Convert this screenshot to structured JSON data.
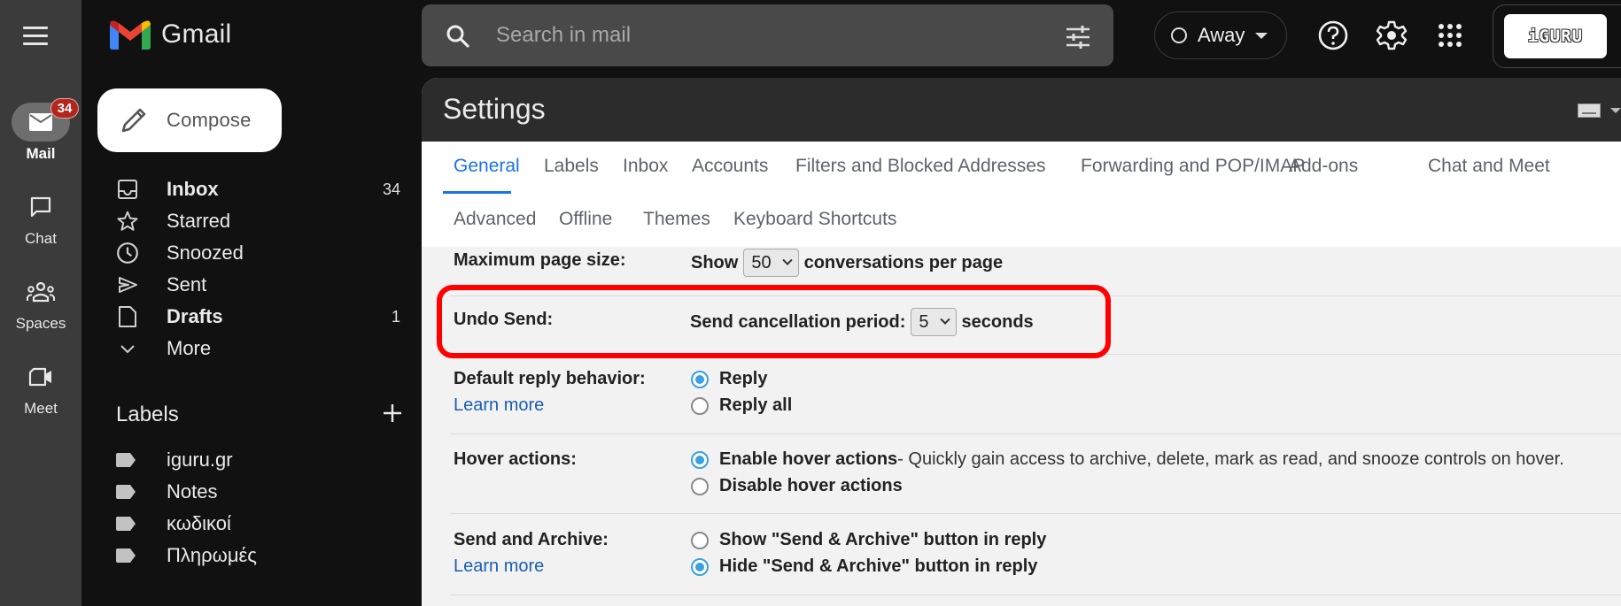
{
  "app": {
    "name": "Gmail"
  },
  "rail": {
    "items": [
      {
        "label": "Mail",
        "icon": "mail-icon",
        "badge": "34",
        "active": true
      },
      {
        "label": "Chat",
        "icon": "chat-icon"
      },
      {
        "label": "Spaces",
        "icon": "spaces-icon"
      },
      {
        "label": "Meet",
        "icon": "video-icon"
      }
    ]
  },
  "compose": {
    "label": "Compose"
  },
  "nav": {
    "items": [
      {
        "label": "Inbox",
        "icon": "inbox-icon",
        "count": "34",
        "bold": true
      },
      {
        "label": "Starred",
        "icon": "star-icon"
      },
      {
        "label": "Snoozed",
        "icon": "clock-icon"
      },
      {
        "label": "Sent",
        "icon": "send-icon"
      },
      {
        "label": "Drafts",
        "icon": "draft-icon",
        "count": "1",
        "bold": true
      },
      {
        "label": "More",
        "icon": "chevron-down-icon"
      }
    ]
  },
  "labels": {
    "title": "Labels",
    "items": [
      {
        "label": "iguru.gr"
      },
      {
        "label": "Notes"
      },
      {
        "label": "κωδικοί"
      },
      {
        "label": "Πληρωμές"
      }
    ]
  },
  "search": {
    "placeholder": "Search in mail",
    "value": ""
  },
  "status": {
    "label": "Away"
  },
  "account": {
    "logo_text": "iGURU"
  },
  "settings": {
    "title": "Settings",
    "tabs_row1": [
      "General",
      "Labels",
      "Inbox",
      "Accounts",
      "Filters and Blocked Addresses",
      "Forwarding and POP/IMAP",
      "Add-ons",
      "Chat and Meet"
    ],
    "tabs_row2": [
      "Advanced",
      "Offline",
      "Themes",
      "Keyboard Shortcuts"
    ],
    "active_tab": "General",
    "rows": {
      "page_size": {
        "label": "Maximum page size:",
        "prefix": "Show",
        "value": "50",
        "suffix": "conversations per page"
      },
      "undo_send": {
        "label": "Undo Send:",
        "prefix": "Send cancellation period:",
        "value": "5",
        "suffix": "seconds"
      },
      "reply": {
        "label": "Default reply behavior:",
        "link": "Learn more",
        "options": [
          "Reply",
          "Reply all"
        ],
        "selected": 0
      },
      "hover": {
        "label": "Hover actions:",
        "options": [
          "Enable hover actions",
          "Disable hover actions"
        ],
        "description": " - Quickly gain access to archive, delete, mark as read, and snooze controls on hover.",
        "selected": 0
      },
      "send_archive": {
        "label": "Send and Archive:",
        "link": "Learn more",
        "options": [
          "Show \"Send & Archive\" button in reply",
          "Hide \"Send & Archive\" button in reply"
        ],
        "selected": 1
      }
    }
  },
  "colors": {
    "accent": "#1a73e8",
    "highlight": "#ff0000",
    "badge": "#b3261e",
    "radio": "#3aa0e0"
  }
}
